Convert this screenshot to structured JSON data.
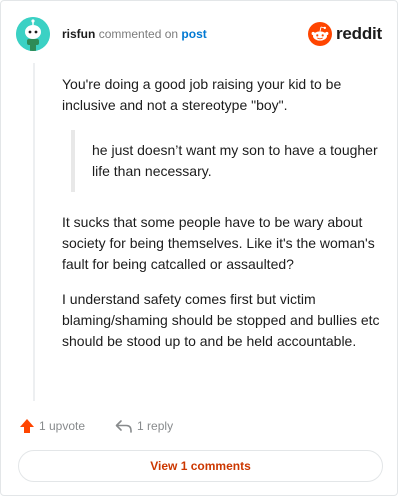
{
  "header": {
    "username": "risfun",
    "commented_text": "commented on",
    "post_link": "post",
    "brand": "reddit"
  },
  "comment": {
    "paragraph1": "You're doing a good job raising your kid to be inclusive and not a stereotype \"boy\".",
    "quote": "he just doesn’t want my son to have a tougher life than necessary.",
    "paragraph2": "It sucks that some people have to be wary about society for being themselves. Like it's the woman's fault for being catcalled or assaulted?",
    "paragraph3": "I understand safety comes first but victim blaming/shaming should be stopped and bullies etc should be stood up to and be held accountable."
  },
  "actions": {
    "upvote_label": "1 upvote",
    "reply_label": "1 reply"
  },
  "footer": {
    "view_comments_label": "View 1 comments"
  },
  "colors": {
    "accent": "#ff4500",
    "link": "#0079d3",
    "view_comments": "#cc3700",
    "avatar": "#3bd1c4"
  },
  "icons": [
    "avatar-icon",
    "reddit-logo-icon",
    "upvote-arrow-icon",
    "reply-arrow-icon"
  ]
}
